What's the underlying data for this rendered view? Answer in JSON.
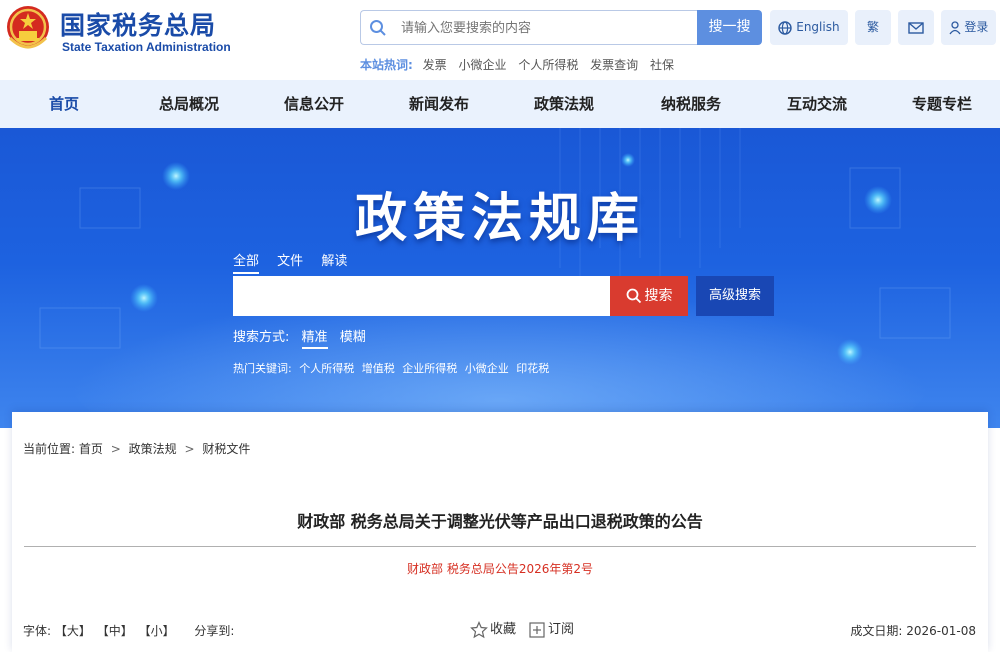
{
  "header": {
    "site_name_cn": "国家税务总局",
    "site_name_en": "State Taxation Administration",
    "search": {
      "placeholder": "请输入您要搜索的内容",
      "button_label": "搜一搜"
    },
    "tools": {
      "english": "English",
      "traditional": "繁",
      "login": "登录"
    },
    "hot_words": {
      "title": "本站热词:",
      "items": [
        "发票",
        "小微企业",
        "个人所得税",
        "发票查询",
        "社保"
      ]
    }
  },
  "nav": {
    "items": [
      "首页",
      "总局概况",
      "信息公开",
      "新闻发布",
      "政策法规",
      "纳税服务",
      "互动交流",
      "专题专栏"
    ],
    "active_index": 0
  },
  "banner": {
    "title": "政策法规库",
    "tabs": [
      "全部",
      "文件",
      "解读"
    ],
    "active_tab": 0,
    "search_button": "搜索",
    "advanced_button": "高级搜索",
    "mode_label": "搜索方式:",
    "modes": [
      "精准",
      "模糊"
    ],
    "hot_label": "热门关键词:",
    "hot_keywords": [
      "个人所得税",
      "增值税",
      "企业所得税",
      "小微企业",
      "印花税"
    ]
  },
  "article": {
    "breadcrumb_label": "当前位置:",
    "breadcrumb": [
      "首页",
      "政策法规",
      "财税文件"
    ],
    "breadcrumb_sep": ">",
    "title": "财政部 税务总局关于调整光伏等产品出口退税政策的公告",
    "doc_number": "财政部 税务总局公告2026年第2号",
    "font_label": "字体:",
    "font_sizes": [
      "【大】",
      "【中】",
      "【小】"
    ],
    "share_label": "分享到:",
    "favorite": "收藏",
    "subscribe": "订阅",
    "date_label": "成文日期:",
    "date": "2026-01-08"
  },
  "colors": {
    "brand_blue": "#1a4ba8",
    "nav_bg": "#eaf2fd",
    "banner_blue": "#1d62e0",
    "search_red": "#d93b2f",
    "doc_number_red": "#d62f22"
  }
}
